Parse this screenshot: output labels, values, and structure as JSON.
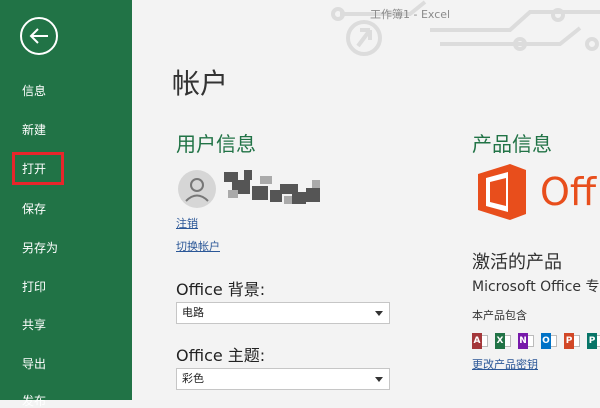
{
  "titlebar": {
    "text": "工作簿1  -  Excel"
  },
  "sidebar": {
    "items": [
      {
        "label": "信息"
      },
      {
        "label": "新建"
      },
      {
        "label": "打开"
      },
      {
        "label": "保存"
      },
      {
        "label": "另存为"
      },
      {
        "label": "打印"
      },
      {
        "label": "共享"
      },
      {
        "label": "导出"
      },
      {
        "label": "发布"
      }
    ]
  },
  "page": {
    "title": "帐户"
  },
  "user_info": {
    "heading": "用户信息",
    "sign_out": "注销",
    "switch_account": "切换帐户",
    "background_label": "Office 背景:",
    "background_value": "电路",
    "theme_label": "Office 主题:",
    "theme_value": "彩色"
  },
  "product_info": {
    "heading": "产品信息",
    "logo_text": "Off",
    "activated": "激活的产品",
    "product_name": "Microsoft Office 专",
    "includes": "本产品包含",
    "change_key": "更改产品密钥",
    "apps": [
      {
        "letter": "A",
        "color": "#a4373a",
        "icon": "access-icon"
      },
      {
        "letter": "X",
        "color": "#217346",
        "icon": "excel-icon"
      },
      {
        "letter": "N",
        "color": "#7719aa",
        "icon": "onenote-icon"
      },
      {
        "letter": "O",
        "color": "#0072c6",
        "icon": "outlook-icon"
      },
      {
        "letter": "P",
        "color": "#d24726",
        "icon": "powerpoint-icon"
      },
      {
        "letter": "P",
        "color": "#077568",
        "icon": "publisher-icon"
      }
    ]
  },
  "colors": {
    "sidebar": "#217346",
    "accent": "#217346",
    "highlight_box": "#e8262b",
    "office_orange": "#e84e1c"
  }
}
